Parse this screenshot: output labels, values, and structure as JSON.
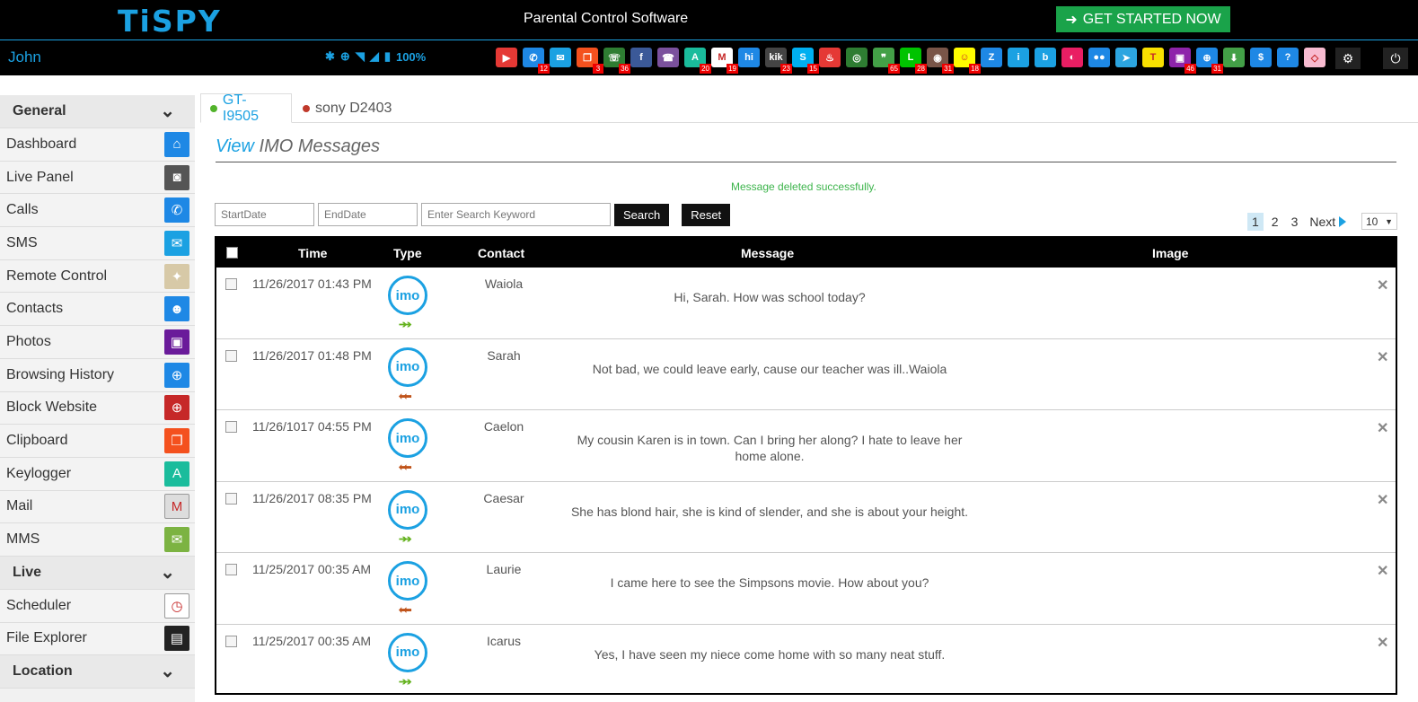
{
  "header": {
    "logo": "TiSPY",
    "title": "Parental Control Software",
    "cta": "GET STARTED NOW"
  },
  "iconbar": {
    "user": "John",
    "battery": "100%",
    "apps": [
      {
        "icon": "video-call-icon",
        "color": "#e53935",
        "glyph": "▶",
        "badge": ""
      },
      {
        "icon": "calls-icon",
        "color": "#1e88e5",
        "glyph": "✆",
        "badge": "12"
      },
      {
        "icon": "sms-icon",
        "color": "#1ba1e2",
        "glyph": "✉",
        "badge": ""
      },
      {
        "icon": "clipboard-icon",
        "color": "#f4511e",
        "glyph": "❐",
        "badge": "3"
      },
      {
        "icon": "whatsapp-icon",
        "color": "#2e7d32",
        "glyph": "☏",
        "badge": "36"
      },
      {
        "icon": "facebook-icon",
        "color": "#3b5998",
        "glyph": "f",
        "badge": ""
      },
      {
        "icon": "viber-icon",
        "color": "#7b519d",
        "glyph": "☎",
        "badge": ""
      },
      {
        "icon": "keylogger-icon",
        "color": "#1abc9c",
        "glyph": "A",
        "badge": "20"
      },
      {
        "icon": "gmail-icon",
        "color": "#ffffff",
        "glyph": "M",
        "badge": "19"
      },
      {
        "icon": "hike-icon",
        "color": "#1e88e5",
        "glyph": "hi",
        "badge": ""
      },
      {
        "icon": "kik-icon",
        "color": "#444444",
        "glyph": "kik",
        "badge": "23"
      },
      {
        "icon": "skype-icon",
        "color": "#00aff0",
        "glyph": "S",
        "badge": "15"
      },
      {
        "icon": "tinder-icon",
        "color": "#e53935",
        "glyph": "♨",
        "badge": ""
      },
      {
        "icon": "wechat-icon",
        "color": "#2e7d32",
        "glyph": "◎",
        "badge": ""
      },
      {
        "icon": "hangouts-icon",
        "color": "#43a047",
        "glyph": "❞",
        "badge": "65"
      },
      {
        "icon": "line-icon",
        "color": "#00c300",
        "glyph": "L",
        "badge": "28"
      },
      {
        "icon": "instagram-icon",
        "color": "#795548",
        "glyph": "◉",
        "badge": "31"
      },
      {
        "icon": "snapchat-icon",
        "color": "#fffc00",
        "glyph": "☺",
        "badge": "18"
      },
      {
        "icon": "zalo-icon",
        "color": "#1e88e5",
        "glyph": "Z",
        "badge": ""
      },
      {
        "icon": "imo-icon",
        "color": "#1ba1e2",
        "glyph": "i",
        "badge": ""
      },
      {
        "icon": "bip-icon",
        "color": "#1ba1e2",
        "glyph": "b",
        "badge": ""
      },
      {
        "icon": "hangout-video-icon",
        "color": "#e91e63",
        "glyph": "◐",
        "badge": ""
      },
      {
        "icon": "flickr-icon",
        "color": "#1e88e5",
        "glyph": "●●",
        "badge": ""
      },
      {
        "icon": "telegram-icon",
        "color": "#2ca5e0",
        "glyph": "➤",
        "badge": ""
      },
      {
        "icon": "kakaotalk-icon",
        "color": "#f9e000",
        "glyph": "T",
        "badge": ""
      },
      {
        "icon": "photos-icon",
        "color": "#8e24aa",
        "glyph": "▣",
        "badge": "46"
      },
      {
        "icon": "browser-icon",
        "color": "#1e88e5",
        "glyph": "⊕",
        "badge": "31"
      },
      {
        "icon": "download-icon",
        "color": "#43a047",
        "glyph": "⬇",
        "badge": ""
      },
      {
        "icon": "dollar-icon",
        "color": "#1e88e5",
        "glyph": "$",
        "badge": ""
      },
      {
        "icon": "help-icon",
        "color": "#1e88e5",
        "glyph": "?",
        "badge": ""
      },
      {
        "icon": "eraser-icon",
        "color": "#f8bbd0",
        "glyph": "◇",
        "badge": ""
      }
    ]
  },
  "sidebar": {
    "sections": [
      {
        "title": "General",
        "items": [
          {
            "label": "Dashboard",
            "icon": "home-icon",
            "color": "#1e88e5",
            "glyph": "⌂"
          },
          {
            "label": "Live Panel",
            "icon": "camera-icon",
            "color": "#555555",
            "glyph": "◙"
          },
          {
            "label": "Calls",
            "icon": "phone-icon",
            "color": "#1e88e5",
            "glyph": "✆"
          },
          {
            "label": "SMS",
            "icon": "envelope-icon",
            "color": "#1ba1e2",
            "glyph": "✉"
          },
          {
            "label": "Remote Control",
            "icon": "map-icon",
            "color": "#d7c9a7",
            "glyph": "✦"
          },
          {
            "label": "Contacts",
            "icon": "contacts-icon",
            "color": "#1e88e5",
            "glyph": "☻"
          },
          {
            "label": "Photos",
            "icon": "photos-icon",
            "color": "#6a1b9a",
            "glyph": "▣"
          },
          {
            "label": "Browsing History",
            "icon": "globe-icon",
            "color": "#1e88e5",
            "glyph": "⊕"
          },
          {
            "label": "Block Website",
            "icon": "globe-block-icon",
            "color": "#c62828",
            "glyph": "⊕"
          },
          {
            "label": "Clipboard",
            "icon": "clipboard-icon",
            "color": "#f4511e",
            "glyph": "❐"
          },
          {
            "label": "Keylogger",
            "icon": "keylogger-icon",
            "color": "#1abc9c",
            "glyph": "A"
          },
          {
            "label": "Mail",
            "icon": "gmail-icon",
            "color": "#dddddd",
            "glyph": "M"
          },
          {
            "label": "MMS",
            "icon": "mms-icon",
            "color": "#7cb342",
            "glyph": "✉"
          }
        ]
      },
      {
        "title": "Live",
        "items": [
          {
            "label": "Scheduler",
            "icon": "clock-icon",
            "color": "#ffffff",
            "glyph": "◷"
          },
          {
            "label": "File Explorer",
            "icon": "sdcard-icon",
            "color": "#222222",
            "glyph": "▤"
          }
        ]
      },
      {
        "title": "Location",
        "items": []
      }
    ]
  },
  "devices": {
    "active": "GT-I9505",
    "active_color": "#52b32b",
    "other": "sony D2403",
    "other_color": "#c0392b"
  },
  "page": {
    "title_hl": "View",
    "title_rest": " IMO Messages",
    "success": "Message deleted successfully.",
    "start_placeholder": "StartDate",
    "end_placeholder": "EndDate",
    "keyword_placeholder": "Enter Search Keyword",
    "search_btn": "Search",
    "reset_btn": "Reset",
    "pages": [
      "1",
      "2",
      "3"
    ],
    "current_page": "1",
    "next": "Next",
    "per_page": "10"
  },
  "table": {
    "headers": {
      "time": "Time",
      "type": "Type",
      "contact": "Contact",
      "message": "Message",
      "image": "Image"
    },
    "rows": [
      {
        "time": "11/26/2017 01:43 PM",
        "direction": "out",
        "contact": "Waiola",
        "message": "Hi, Sarah. How was school today?"
      },
      {
        "time": "11/26/2017 01:48 PM",
        "direction": "in",
        "contact": "Sarah",
        "message": "Not bad, we could leave early, cause our teacher was ill..Waiola"
      },
      {
        "time": "11/26/1017 04:55 PM",
        "direction": "in",
        "contact": "Caelon",
        "message": "My cousin Karen is in town. Can I bring her along? I hate to leave her home alone."
      },
      {
        "time": "11/26/2017 08:35 PM",
        "direction": "out",
        "contact": "Caesar",
        "message": "She has blond hair, she is kind of slender, and she is about your height."
      },
      {
        "time": "11/25/2017 00:35 AM",
        "direction": "in",
        "contact": "Laurie",
        "message": "I came here to see the Simpsons movie. How about you?"
      },
      {
        "time": "11/25/2017 00:35 AM",
        "direction": "out",
        "contact": "Icarus",
        "message": "Yes, I have seen my niece come home with so many neat stuff."
      }
    ],
    "imo_label": "imo"
  }
}
